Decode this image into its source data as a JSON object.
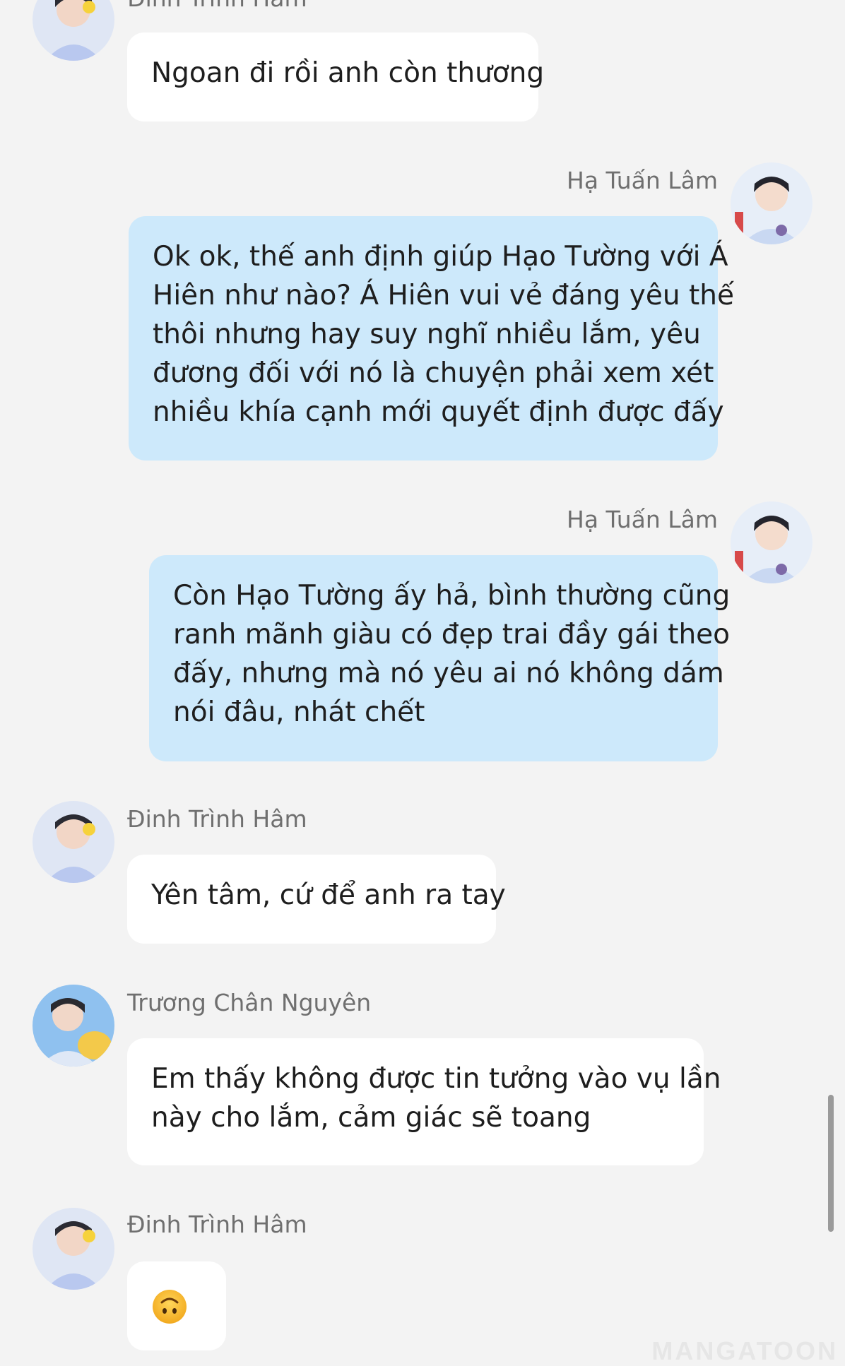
{
  "colors": {
    "background": "#f3f3f3",
    "incoming_bubble": "#ffffff",
    "outgoing_bubble": "#cde9fb",
    "name_text": "#6f6f6f",
    "message_text": "#1e1e1e"
  },
  "messages": [
    {
      "sender": "Đinh Trình Hâm",
      "direction": "incoming",
      "lines": [
        "Ngoan đi rồi anh còn thương"
      ]
    },
    {
      "sender": "Hạ Tuấn Lâm",
      "direction": "outgoing",
      "lines": [
        "Ok ok, thế anh định giúp Hạo Tường với Á",
        "Hiên như nào? Á Hiên vui vẻ đáng yêu thế",
        "thôi nhưng hay suy nghĩ nhiều lắm, yêu",
        "đương đối với nó là chuyện phải xem xét",
        "nhiều khía cạnh mới quyết định được đấy"
      ]
    },
    {
      "sender": "Hạ Tuấn Lâm",
      "direction": "outgoing",
      "lines": [
        "Còn Hạo Tường ấy hả, bình thường cũng",
        "ranh mãnh giàu có đẹp trai đầy gái theo",
        "đấy, nhưng mà nó yêu ai nó không dám",
        "nói đâu, nhát chết"
      ]
    },
    {
      "sender": "Đinh Trình Hâm",
      "direction": "incoming",
      "lines": [
        "Yên tâm, cứ để anh ra tay"
      ]
    },
    {
      "sender": "Trương Chân Nguyên",
      "direction": "incoming",
      "lines": [
        "Em thấy không được tin tưởng vào vụ lần",
        "này cho lắm, cảm giác sẽ toang"
      ]
    },
    {
      "sender": "Đinh Trình Hâm",
      "direction": "incoming",
      "emoji": "upside-down-face-icon"
    }
  ],
  "watermark": "MANGATOON"
}
